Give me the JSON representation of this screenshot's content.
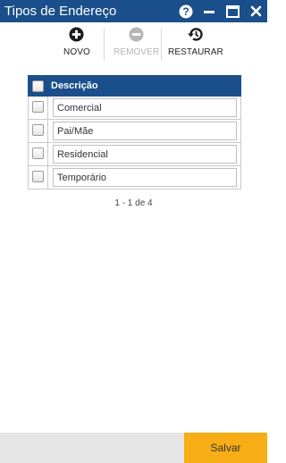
{
  "window": {
    "title": "Tipos de Endereço"
  },
  "titlebar_icons": [
    "help-icon",
    "minimize-icon",
    "maximize-icon",
    "close-icon"
  ],
  "toolbar": {
    "new_label": "NOVO",
    "remove_label": "REMOVER",
    "restore_label": "RESTAURAR",
    "remove_disabled": true
  },
  "grid": {
    "header": "Descrição",
    "rows": [
      "Comercial",
      "Pai/Mãe",
      "Residencial",
      "Temporário"
    ],
    "pager": "1 - 1 de 4"
  },
  "footer": {
    "save_label": "Salvar"
  },
  "colors": {
    "primary": "#1a4f8b",
    "accent": "#f7ad16",
    "footer_bg": "#e5e5e5"
  }
}
